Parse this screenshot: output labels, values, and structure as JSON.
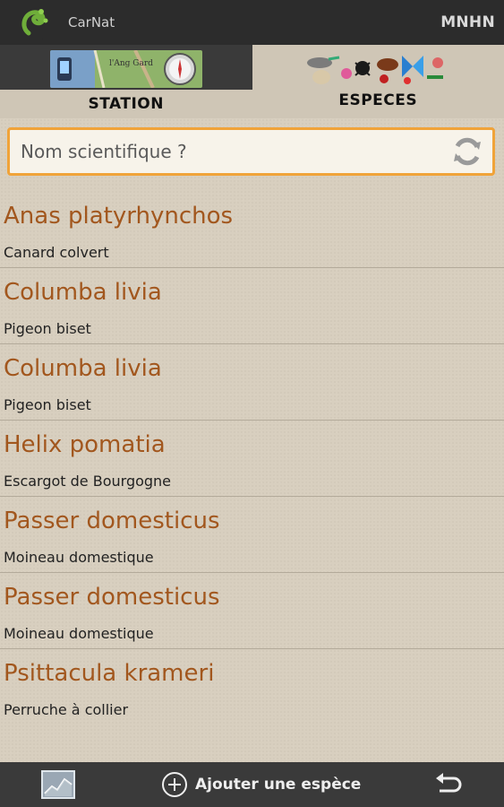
{
  "app": {
    "title": "CarNat",
    "action": "MNHN"
  },
  "tabs": [
    {
      "label": "STATION",
      "image_text": "l'Ang Gard"
    },
    {
      "label": "ESPECES"
    }
  ],
  "search": {
    "placeholder": "Nom scientifique ?",
    "value": ""
  },
  "species": [
    {
      "scientific": "Anas platyrhynchos",
      "common": "Canard colvert"
    },
    {
      "scientific": "Columba livia",
      "common": "Pigeon biset"
    },
    {
      "scientific": "Columba livia",
      "common": "Pigeon biset"
    },
    {
      "scientific": "Helix pomatia",
      "common": "Escargot de Bourgogne"
    },
    {
      "scientific": "Passer domesticus",
      "common": "Moineau domestique"
    },
    {
      "scientific": "Passer domesticus",
      "common": "Moineau domestique"
    },
    {
      "scientific": "Psittacula krameri",
      "common": "Perruche à collier"
    }
  ],
  "bottom": {
    "add_label": "Ajouter une espèce"
  },
  "colors": {
    "accent": "#f0a339",
    "scientific_text": "#a2571e",
    "bar": "#2c2c2c"
  }
}
